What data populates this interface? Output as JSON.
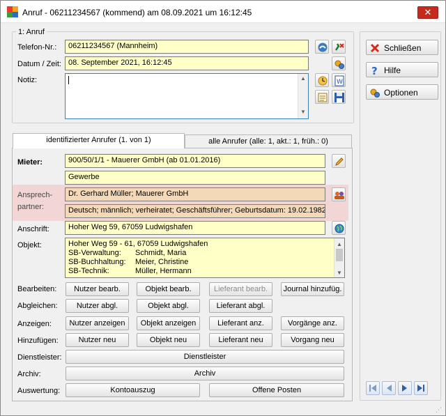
{
  "window": {
    "title": "Anruf - 06211234567 (kommend) am 08.09.2021 um 16:12:45",
    "icon": "app-logo-icon"
  },
  "call_group": {
    "legend": "1: Anruf",
    "phone_label": "Telefon-Nr.:",
    "phone_value": "06211234567  (Mannheim)",
    "datetime_label": "Datum / Zeit:",
    "datetime_value": "08. September 2021,  16:12:45",
    "note_label": "Notiz:",
    "note_value": ""
  },
  "side": {
    "close_label": "Schließen",
    "help_label": "Hilfe",
    "options_label": "Optionen"
  },
  "tabs": {
    "identified": "identifizierter Anrufer  (1. von 1)",
    "all": "alle Anrufer (alle: 1,  akt.: 1,  früh.: 0)"
  },
  "caller": {
    "tenant_label": "Mieter:",
    "tenant_value": "900/50/1/1 - Mauerer GmbH  (ab 01.01.2016)",
    "tenant_type": "Gewerbe",
    "contact_label_1": "Ansprech-",
    "contact_label_2": "partner:",
    "contact_name": "Dr. Gerhard Müller;  Mauerer GmbH",
    "contact_details": "Deutsch;  männlich;  verheiratet;  Geschäftsführer;  Geburtsdatum: 19.02.1982",
    "address_label": "Anschrift:",
    "address_value": "Hoher Weg 59, 67059 Ludwigshafen",
    "object_label": "Objekt:",
    "object_lines": [
      {
        "key": "Hoher Weg 59 - 61, 67059 Ludwigshafen",
        "value": ""
      },
      {
        "key": "SB-Verwaltung:",
        "value": "Schmidt, Maria"
      },
      {
        "key": "SB-Buchhaltung:",
        "value": "Meier, Christine"
      },
      {
        "key": "SB-Technik:",
        "value": "Müller, Hermann"
      }
    ]
  },
  "actions": {
    "edit_label": "Bearbeiten:",
    "edit_user": "Nutzer bearb.",
    "edit_object": "Objekt bearb.",
    "edit_supplier": "Lieferant bearb.",
    "edit_journal": "Journal hinzufüg.",
    "sync_label": "Abgleichen:",
    "sync_user": "Nutzer abgl.",
    "sync_object": "Objekt abgl.",
    "sync_supplier": "Lieferant abgl.",
    "show_label": "Anzeigen:",
    "show_user": "Nutzer anzeigen",
    "show_object": "Objekt anzeigen",
    "show_supplier": "Lieferant anz.",
    "show_process": "Vorgänge anz.",
    "add_label": "Hinzufügen:",
    "add_user": "Nutzer neu",
    "add_object": "Objekt neu",
    "add_supplier": "Lieferant neu",
    "add_process": "Vorgang neu",
    "service_label": "Dienstleister:",
    "service_button": "Dienstleister",
    "archive_label": "Archiv:",
    "archive_button": "Archiv",
    "eval_label": "Auswertung:",
    "eval_account": "Kontoauszug",
    "eval_open": "Offene Posten"
  },
  "colors": {
    "field_bg": "#ffffc8",
    "highlight": "#f2d6d6",
    "close_red": "#c42b1c"
  }
}
